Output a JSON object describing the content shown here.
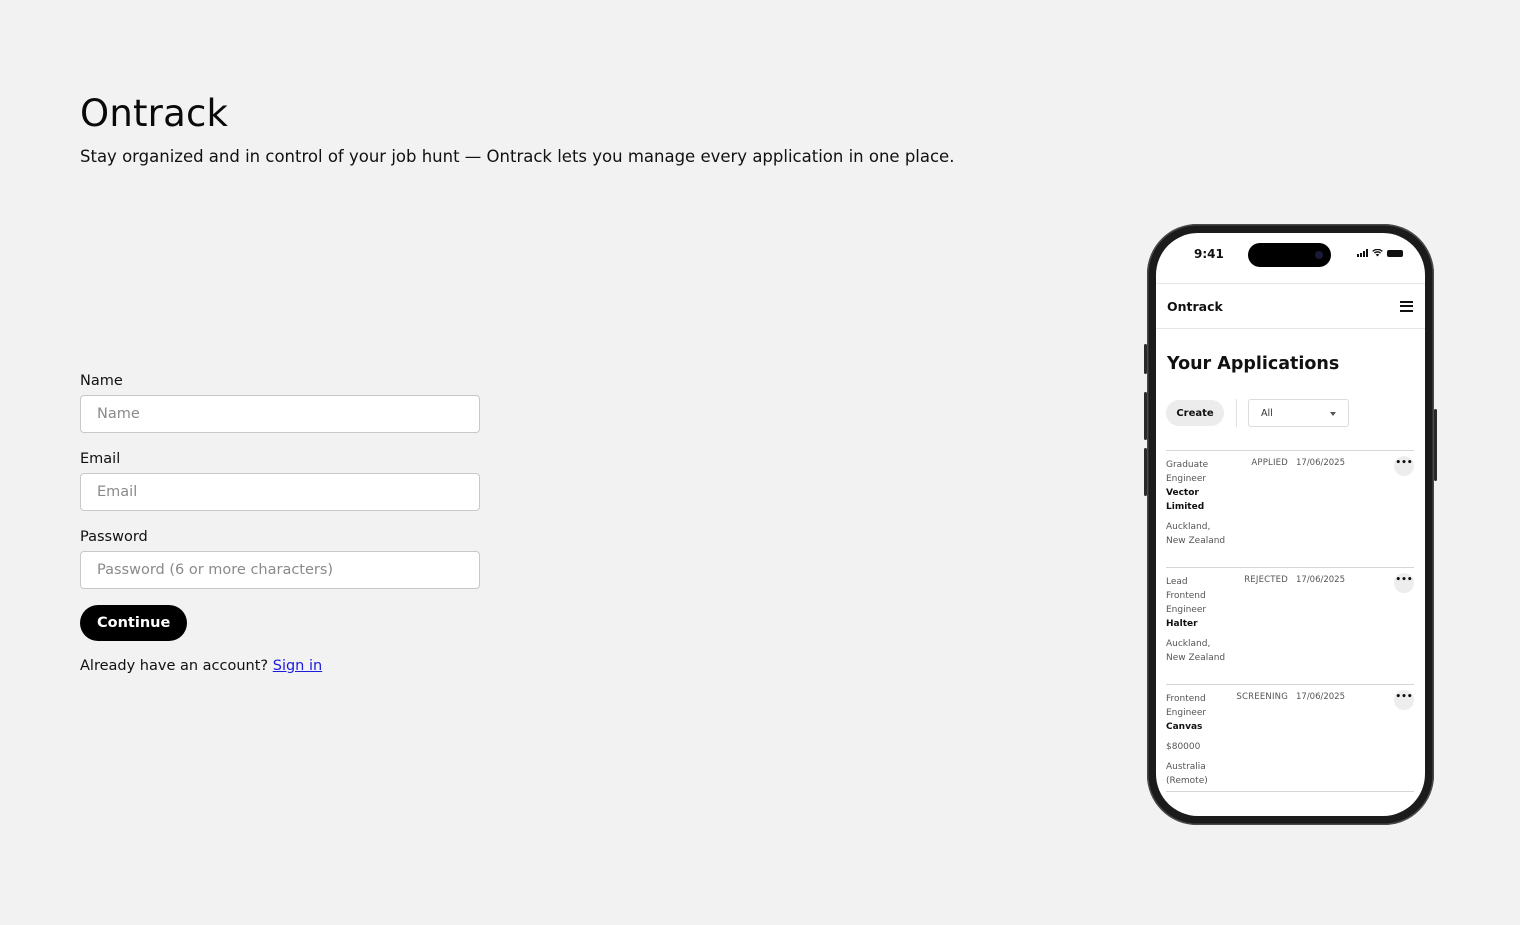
{
  "hero": {
    "title": "Ontrack",
    "subtitle": "Stay organized and in control of your job hunt — Ontrack lets you manage every application in one place."
  },
  "form": {
    "name_label": "Name",
    "name_placeholder": "Name",
    "email_label": "Email",
    "email_placeholder": "Email",
    "password_label": "Password",
    "password_placeholder": "Password (6 or more characters)",
    "continue_label": "Continue",
    "signin_prompt": "Already have an account?",
    "signin_link": "Sign in"
  },
  "phone": {
    "status_time": "9:41",
    "brand": "Ontrack",
    "menu_icon": "hamburger-icon",
    "page_title": "Your Applications",
    "create_label": "Create",
    "filter_value": "All",
    "more_label": "•••",
    "applications": [
      {
        "role": "Graduate Engineer",
        "company": "Vector Limited",
        "extra": "",
        "location": "Auckland, New Zealand",
        "status": "APPLIED",
        "date": "17/06/2025"
      },
      {
        "role": "Lead Frontend Engineer",
        "company": "Halter",
        "extra": "",
        "location": "Auckland, New Zealand",
        "status": "REJECTED",
        "date": "17/06/2025"
      },
      {
        "role": "Frontend Engineer",
        "company": "Canvas",
        "extra": "$80000",
        "location": "Australia (Remote)",
        "status": "SCREENING",
        "date": "17/06/2025"
      }
    ]
  },
  "colors": {
    "background": "#f2f2f2",
    "button": "#000000",
    "link": "#1a1ae0"
  }
}
